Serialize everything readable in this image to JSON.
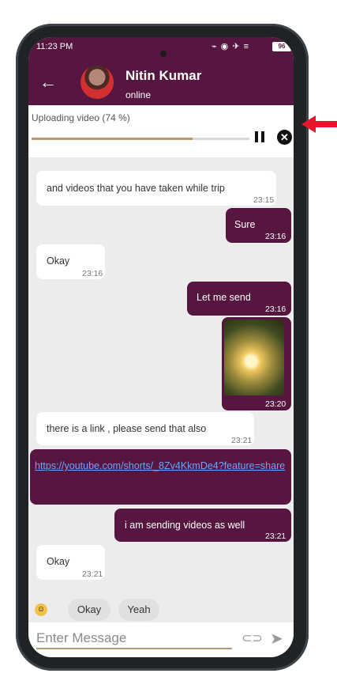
{
  "status_bar": {
    "time": "11:23 PM",
    "icons": "⌁ ◉ ✈ ≡",
    "battery": "96"
  },
  "header": {
    "back_icon": "arrow-left-icon",
    "name": "Nitin Kumar",
    "status": "online"
  },
  "upload": {
    "text": "Uploading video (74 %)",
    "progress": 0.74
  },
  "messages": [
    {
      "dir": "in",
      "text": "and videos that you have taken while trip",
      "time": "23:15"
    },
    {
      "dir": "out",
      "text": "Sure",
      "time": "23:16"
    },
    {
      "dir": "in",
      "text": "Okay",
      "time": "23:16"
    },
    {
      "dir": "out",
      "text": "Let me send",
      "time": "23:16"
    },
    {
      "dir": "out",
      "type": "image",
      "time": "23:20"
    },
    {
      "dir": "in",
      "text": "there is a link , please send that also",
      "time": "23:21"
    },
    {
      "dir": "out",
      "type": "link",
      "text": "https://youtube.com/shorts/_8Zv4KkmDe4?feature=share"
    },
    {
      "dir": "out",
      "text": "i am sending videos as well",
      "time": "23:21"
    },
    {
      "dir": "in",
      "text": "Okay",
      "time": "23:21"
    }
  ],
  "quick_replies": [
    "Okay",
    "Yeah"
  ],
  "input": {
    "placeholder": "Enter Message"
  },
  "colors": {
    "brand": "#56163f",
    "accent": "#b79a6e",
    "annotation_arrow": "#e8162a"
  }
}
